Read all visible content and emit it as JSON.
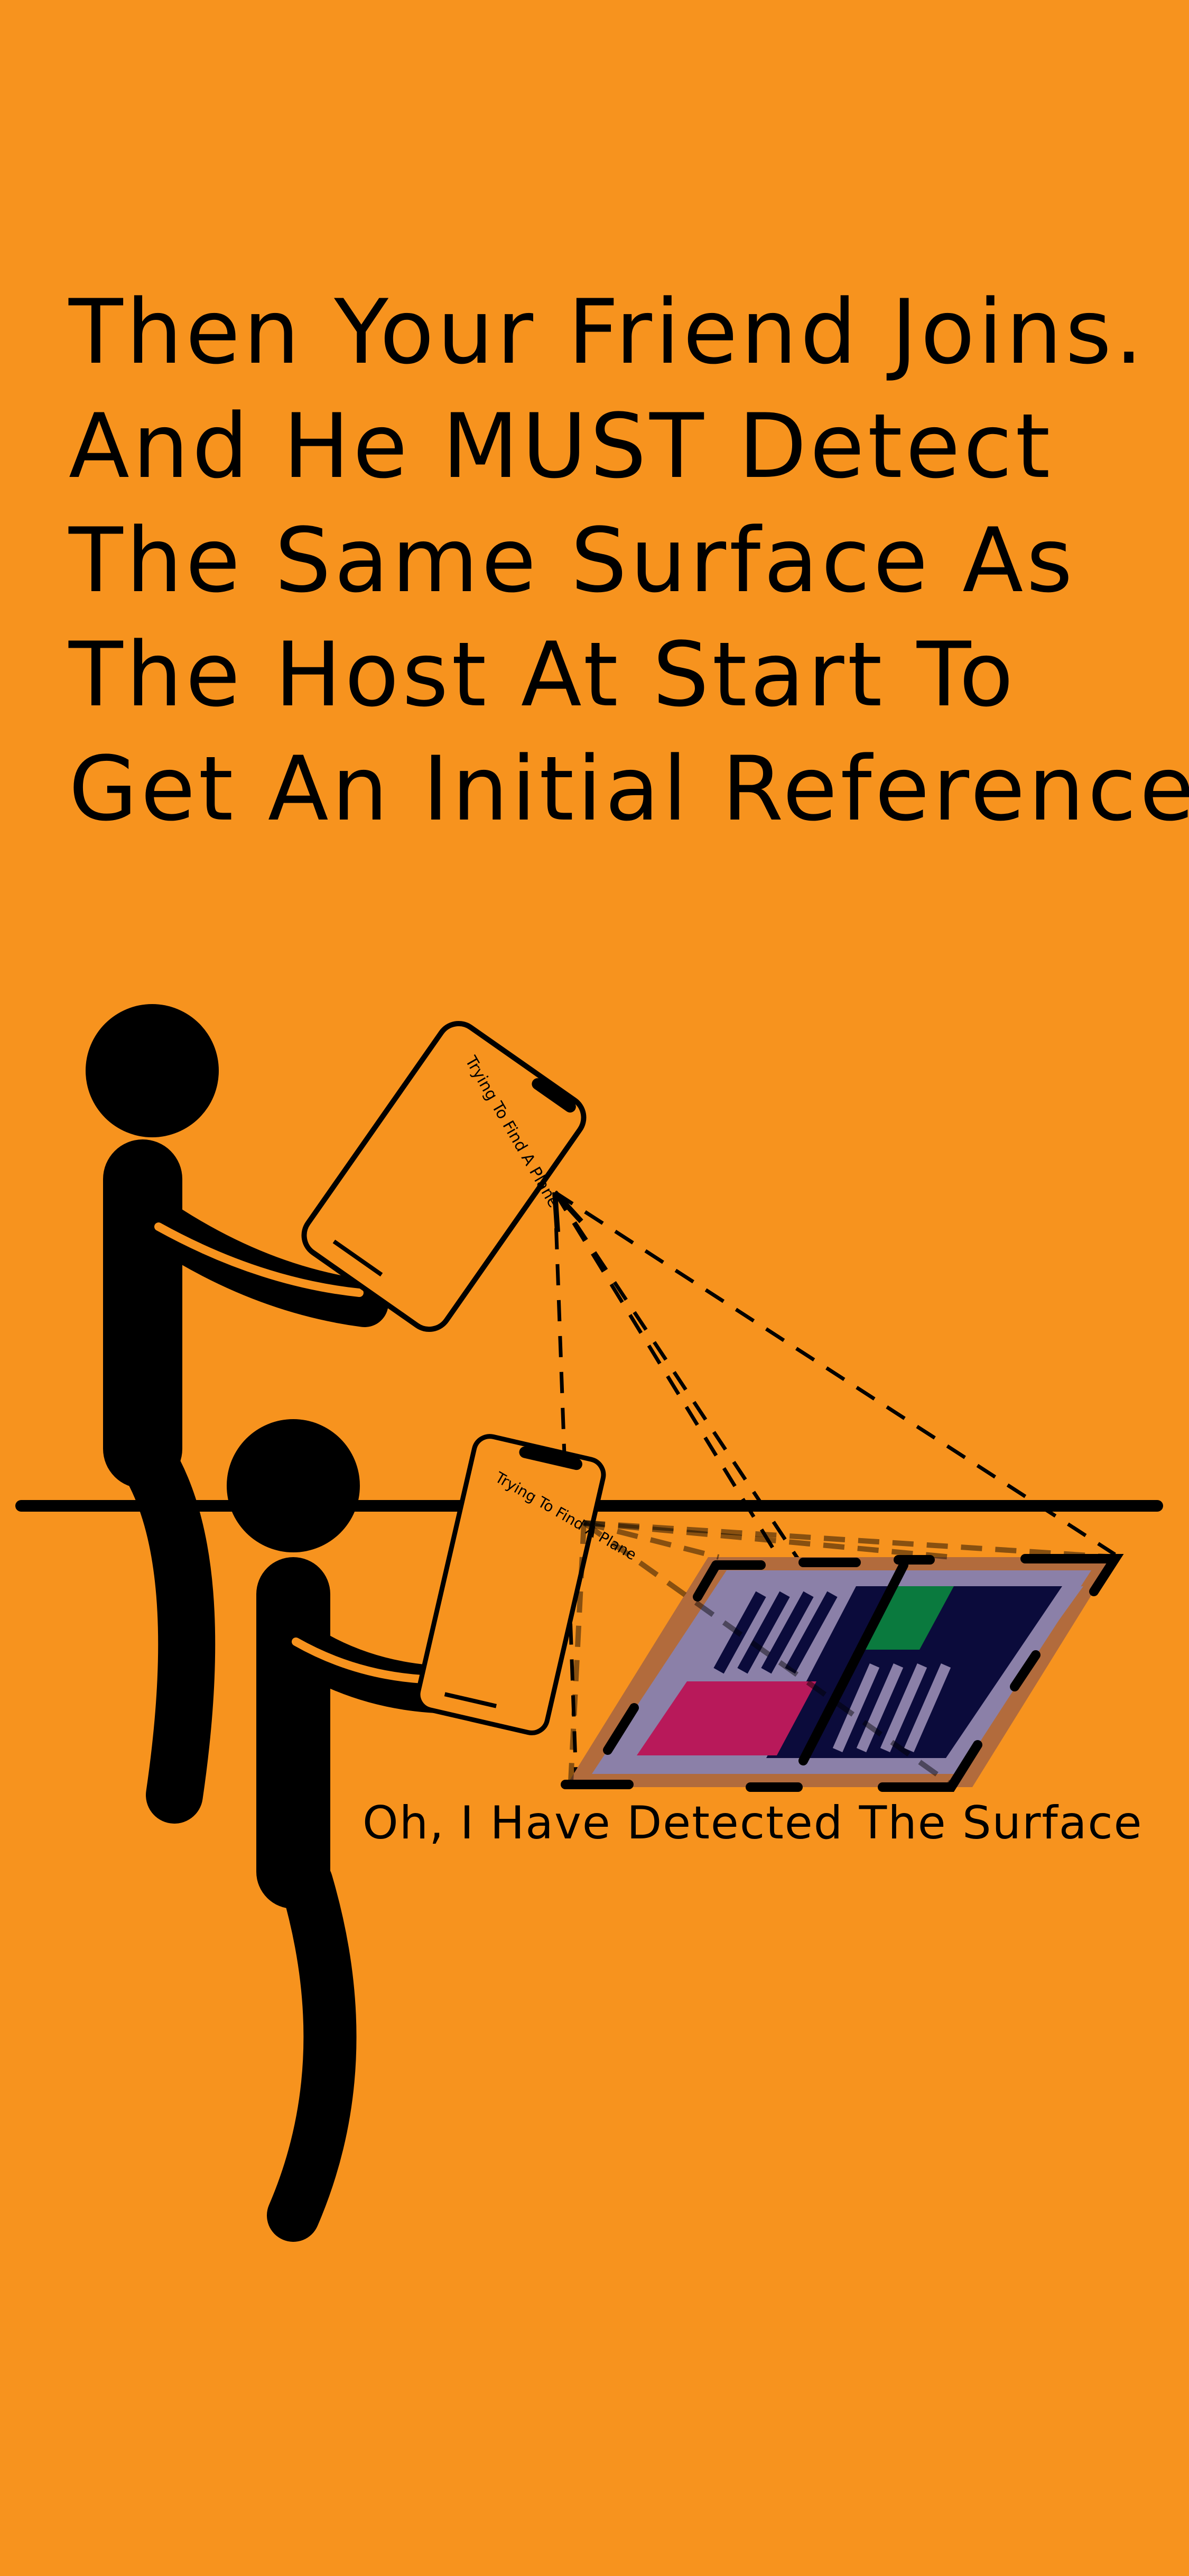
{
  "headline_lines": [
    "Then Your Friend Joins.",
    "And He MUST Detect",
    "The Same Surface As",
    "The Host At Start To",
    "Get An Initial Reference"
  ],
  "phone_screen_text_host": "Trying To Find A Plane",
  "phone_screen_text_friend": "Trying To Find A Plane",
  "caption": "Oh, I Have Detected The Surface",
  "colors": {
    "background": "#F7931E",
    "figure": "#000000",
    "surface_border": "#B26B3C",
    "surface_fill": "#8B80A8",
    "panel_dark": "#0B0B3B",
    "panel_green": "#0A7A3E",
    "panel_magenta": "#B8195A"
  },
  "icons": [
    "person-standing-icon",
    "person-seated-icon",
    "phone-icon",
    "detected-plane-icon"
  ]
}
